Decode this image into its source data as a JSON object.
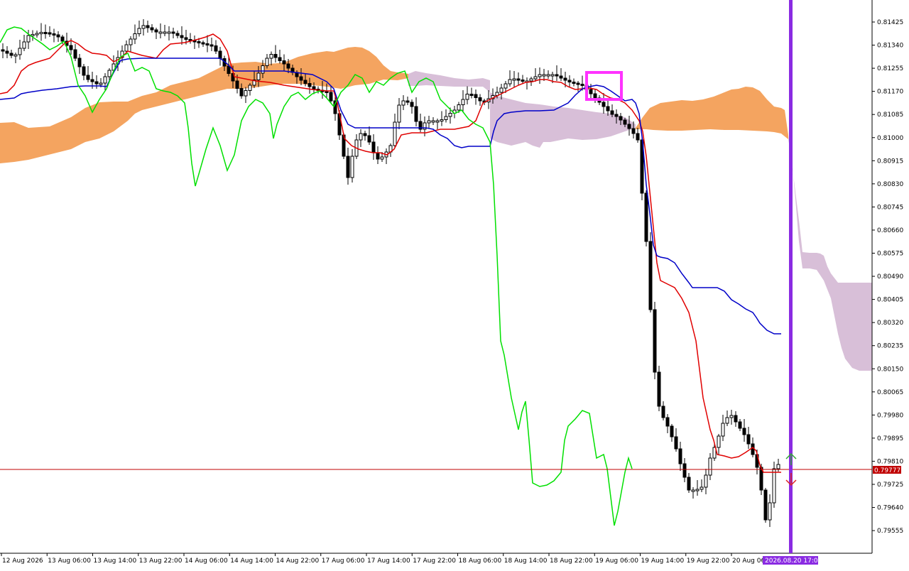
{
  "chart_data": {
    "type": "candlestick",
    "price_axis_labels": [
      "0.81425",
      "0.81340",
      "0.81255",
      "0.81170",
      "0.81085",
      "0.81000",
      "0.80915",
      "0.80830",
      "0.80745",
      "0.80660",
      "0.80575",
      "0.80490",
      "0.80405",
      "0.80320",
      "0.80235",
      "0.80150",
      "0.80065",
      "0.79980",
      "0.79895",
      "0.79810",
      "0.79725",
      "0.79640",
      "0.79555"
    ],
    "time_axis_labels": [
      "12 Aug 2026",
      "13 Aug 06:00",
      "13 Aug 14:00",
      "13 Aug 22:00",
      "14 Aug 06:00",
      "14 Aug 14:00",
      "14 Aug 22:00",
      "17 Aug 06:00",
      "17 Aug 14:00",
      "17 Aug 22:00",
      "18 Aug 06:00",
      "18 Aug 14:00",
      "18 Aug 22:00",
      "19 Aug 06:00",
      "19 Aug 14:00",
      "19 Aug 22:00",
      "20 Aug 06:00"
    ],
    "current_price": "0.79777",
    "cursor_time_label": "2026.08.20 17:00",
    "colors": {
      "tenkan": "#e00000",
      "kijun": "#0000c8",
      "chikou": "#00e000",
      "kumo_bull": "#f4a460",
      "kumo_bear": "#d8bfd8",
      "highlight_box": "#ff33ff",
      "vertical_line": "#8a2be2",
      "price_line": "#c00000",
      "arrow_up": "#33aa33",
      "arrow_down": "#dd2222"
    }
  }
}
